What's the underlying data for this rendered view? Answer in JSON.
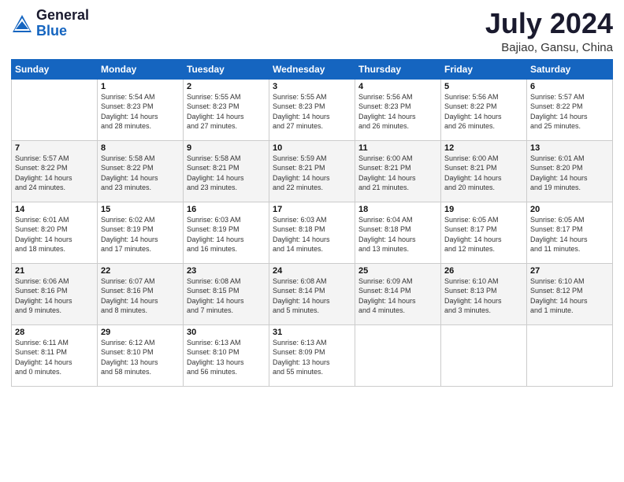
{
  "header": {
    "logo_general": "General",
    "logo_blue": "Blue",
    "month_title": "July 2024",
    "location": "Bajiao, Gansu, China"
  },
  "weekdays": [
    "Sunday",
    "Monday",
    "Tuesday",
    "Wednesday",
    "Thursday",
    "Friday",
    "Saturday"
  ],
  "weeks": [
    [
      {
        "day": "",
        "info": ""
      },
      {
        "day": "1",
        "info": "Sunrise: 5:54 AM\nSunset: 8:23 PM\nDaylight: 14 hours\nand 28 minutes."
      },
      {
        "day": "2",
        "info": "Sunrise: 5:55 AM\nSunset: 8:23 PM\nDaylight: 14 hours\nand 27 minutes."
      },
      {
        "day": "3",
        "info": "Sunrise: 5:55 AM\nSunset: 8:23 PM\nDaylight: 14 hours\nand 27 minutes."
      },
      {
        "day": "4",
        "info": "Sunrise: 5:56 AM\nSunset: 8:23 PM\nDaylight: 14 hours\nand 26 minutes."
      },
      {
        "day": "5",
        "info": "Sunrise: 5:56 AM\nSunset: 8:22 PM\nDaylight: 14 hours\nand 26 minutes."
      },
      {
        "day": "6",
        "info": "Sunrise: 5:57 AM\nSunset: 8:22 PM\nDaylight: 14 hours\nand 25 minutes."
      }
    ],
    [
      {
        "day": "7",
        "info": "Sunrise: 5:57 AM\nSunset: 8:22 PM\nDaylight: 14 hours\nand 24 minutes."
      },
      {
        "day": "8",
        "info": "Sunrise: 5:58 AM\nSunset: 8:22 PM\nDaylight: 14 hours\nand 23 minutes."
      },
      {
        "day": "9",
        "info": "Sunrise: 5:58 AM\nSunset: 8:21 PM\nDaylight: 14 hours\nand 23 minutes."
      },
      {
        "day": "10",
        "info": "Sunrise: 5:59 AM\nSunset: 8:21 PM\nDaylight: 14 hours\nand 22 minutes."
      },
      {
        "day": "11",
        "info": "Sunrise: 6:00 AM\nSunset: 8:21 PM\nDaylight: 14 hours\nand 21 minutes."
      },
      {
        "day": "12",
        "info": "Sunrise: 6:00 AM\nSunset: 8:21 PM\nDaylight: 14 hours\nand 20 minutes."
      },
      {
        "day": "13",
        "info": "Sunrise: 6:01 AM\nSunset: 8:20 PM\nDaylight: 14 hours\nand 19 minutes."
      }
    ],
    [
      {
        "day": "14",
        "info": "Sunrise: 6:01 AM\nSunset: 8:20 PM\nDaylight: 14 hours\nand 18 minutes."
      },
      {
        "day": "15",
        "info": "Sunrise: 6:02 AM\nSunset: 8:19 PM\nDaylight: 14 hours\nand 17 minutes."
      },
      {
        "day": "16",
        "info": "Sunrise: 6:03 AM\nSunset: 8:19 PM\nDaylight: 14 hours\nand 16 minutes."
      },
      {
        "day": "17",
        "info": "Sunrise: 6:03 AM\nSunset: 8:18 PM\nDaylight: 14 hours\nand 14 minutes."
      },
      {
        "day": "18",
        "info": "Sunrise: 6:04 AM\nSunset: 8:18 PM\nDaylight: 14 hours\nand 13 minutes."
      },
      {
        "day": "19",
        "info": "Sunrise: 6:05 AM\nSunset: 8:17 PM\nDaylight: 14 hours\nand 12 minutes."
      },
      {
        "day": "20",
        "info": "Sunrise: 6:05 AM\nSunset: 8:17 PM\nDaylight: 14 hours\nand 11 minutes."
      }
    ],
    [
      {
        "day": "21",
        "info": "Sunrise: 6:06 AM\nSunset: 8:16 PM\nDaylight: 14 hours\nand 9 minutes."
      },
      {
        "day": "22",
        "info": "Sunrise: 6:07 AM\nSunset: 8:16 PM\nDaylight: 14 hours\nand 8 minutes."
      },
      {
        "day": "23",
        "info": "Sunrise: 6:08 AM\nSunset: 8:15 PM\nDaylight: 14 hours\nand 7 minutes."
      },
      {
        "day": "24",
        "info": "Sunrise: 6:08 AM\nSunset: 8:14 PM\nDaylight: 14 hours\nand 5 minutes."
      },
      {
        "day": "25",
        "info": "Sunrise: 6:09 AM\nSunset: 8:14 PM\nDaylight: 14 hours\nand 4 minutes."
      },
      {
        "day": "26",
        "info": "Sunrise: 6:10 AM\nSunset: 8:13 PM\nDaylight: 14 hours\nand 3 minutes."
      },
      {
        "day": "27",
        "info": "Sunrise: 6:10 AM\nSunset: 8:12 PM\nDaylight: 14 hours\nand 1 minute."
      }
    ],
    [
      {
        "day": "28",
        "info": "Sunrise: 6:11 AM\nSunset: 8:11 PM\nDaylight: 14 hours\nand 0 minutes."
      },
      {
        "day": "29",
        "info": "Sunrise: 6:12 AM\nSunset: 8:10 PM\nDaylight: 13 hours\nand 58 minutes."
      },
      {
        "day": "30",
        "info": "Sunrise: 6:13 AM\nSunset: 8:10 PM\nDaylight: 13 hours\nand 56 minutes."
      },
      {
        "day": "31",
        "info": "Sunrise: 6:13 AM\nSunset: 8:09 PM\nDaylight: 13 hours\nand 55 minutes."
      },
      {
        "day": "",
        "info": ""
      },
      {
        "day": "",
        "info": ""
      },
      {
        "day": "",
        "info": ""
      }
    ]
  ]
}
